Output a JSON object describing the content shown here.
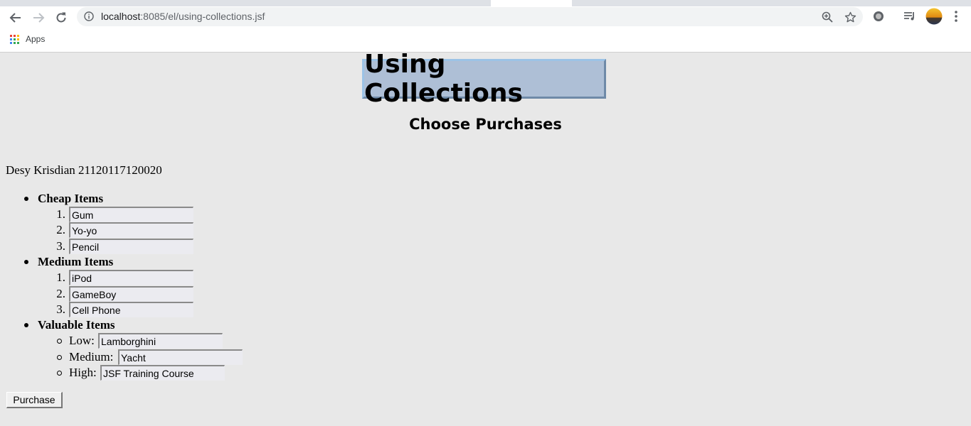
{
  "browser": {
    "url_host": "localhost",
    "url_path": ":8085/el/using-collections.jsf",
    "bookmarks_apps_label": "Apps"
  },
  "page": {
    "title": "Using Collections",
    "subtitle": "Choose Purchases",
    "author": "Desy Krisdian 21120117120020",
    "categories": [
      {
        "label": "Cheap Items",
        "items": [
          {
            "marker": "1.",
            "value": "Gum"
          },
          {
            "marker": "2.",
            "value": "Yo-yo"
          },
          {
            "marker": "3.",
            "value": "Pencil"
          }
        ]
      },
      {
        "label": "Medium Items",
        "items": [
          {
            "marker": "1.",
            "value": "iPod"
          },
          {
            "marker": "2.",
            "value": "GameBoy"
          },
          {
            "marker": "3.",
            "value": "Cell Phone"
          }
        ]
      },
      {
        "label": "Valuable Items",
        "items": [
          {
            "label": "Low:",
            "value": "Lamborghini"
          },
          {
            "label": "Medium:",
            "value": "Yacht"
          },
          {
            "label": "High:",
            "value": "JSF Training Course"
          }
        ]
      }
    ],
    "purchase_label": "Purchase"
  }
}
